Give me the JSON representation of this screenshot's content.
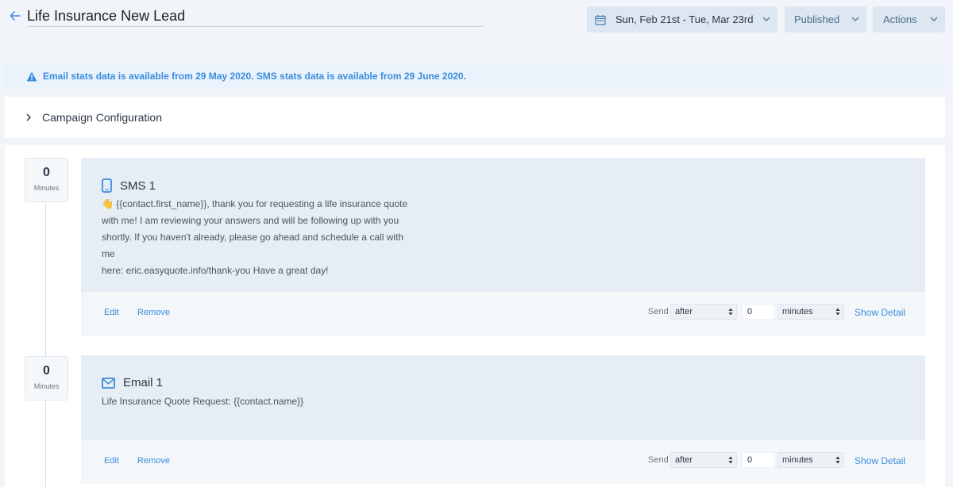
{
  "header": {
    "title": "Life Insurance New Lead",
    "date_range": "Sun, Feb 21st - Tue, Mar 23rd",
    "status_label": "Published",
    "actions_label": "Actions"
  },
  "alert": {
    "text": "Email stats data is available from 29 May 2020. SMS stats data is available from 29 June 2020."
  },
  "config": {
    "label": "Campaign Configuration"
  },
  "steps": [
    {
      "delay_value": "0",
      "delay_unit": "Minutes",
      "type_icon": "phone-icon",
      "title": "SMS 1",
      "lines": [
        "👋 {{contact.first_name}}, thank you for requesting a life insurance quote",
        "with me! I am reviewing your answers and will be following up with you",
        "shortly. If you haven't already, please go ahead and schedule a call with me",
        "here: eric.easyquote.info/thank-you   Have a great day!"
      ],
      "edit_label": "Edit",
      "remove_label": "Remove",
      "send_label": "Send",
      "when_value": "after",
      "amount_value": "0",
      "unit_value": "minutes",
      "detail_label": "Show Detail"
    },
    {
      "delay_value": "0",
      "delay_unit": "Minutes",
      "type_icon": "envelope-icon",
      "title": "Email 1",
      "lines": [
        "Life Insurance Quote Request: {{contact.name}}"
      ],
      "edit_label": "Edit",
      "remove_label": "Remove",
      "send_label": "Send",
      "when_value": "after",
      "amount_value": "0",
      "unit_value": "minutes",
      "detail_label": "Show Detail"
    }
  ],
  "colors": {
    "accent": "#3a8dde",
    "card_bg": "#e6edf4",
    "button_bg": "#dde7f1"
  }
}
